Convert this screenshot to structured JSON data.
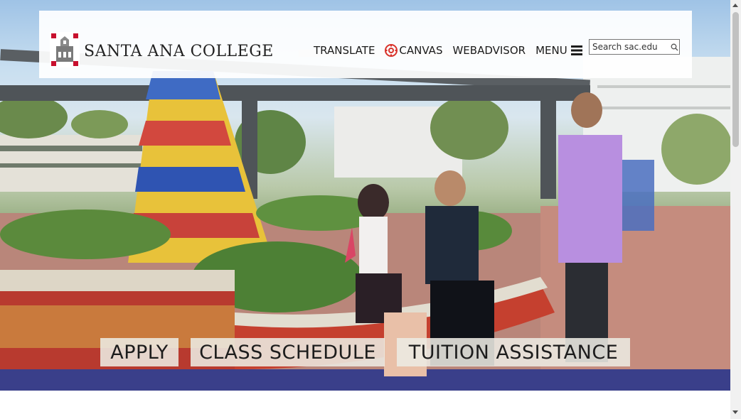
{
  "site": {
    "name": "SANTA ANA COLLEGE"
  },
  "nav": {
    "translate": "TRANSLATE",
    "canvas": "CANVAS",
    "webadvisor": "WEBADVISOR",
    "menu": "MENU"
  },
  "search": {
    "placeholder": "Search sac.edu"
  },
  "cta": {
    "apply": "APPLY",
    "class_schedule": "CLASS SCHEDULE",
    "tuition_assistance": "TUITION ASSISTANCE"
  },
  "colors": {
    "brand_red": "#c8102e",
    "header_bg": "#ffffff",
    "cta_bg": "#eceae2"
  },
  "icons": {
    "logo": "mission-building-logo-icon",
    "canvas": "canvas-icon",
    "menu": "hamburger-icon",
    "search": "search-icon"
  }
}
